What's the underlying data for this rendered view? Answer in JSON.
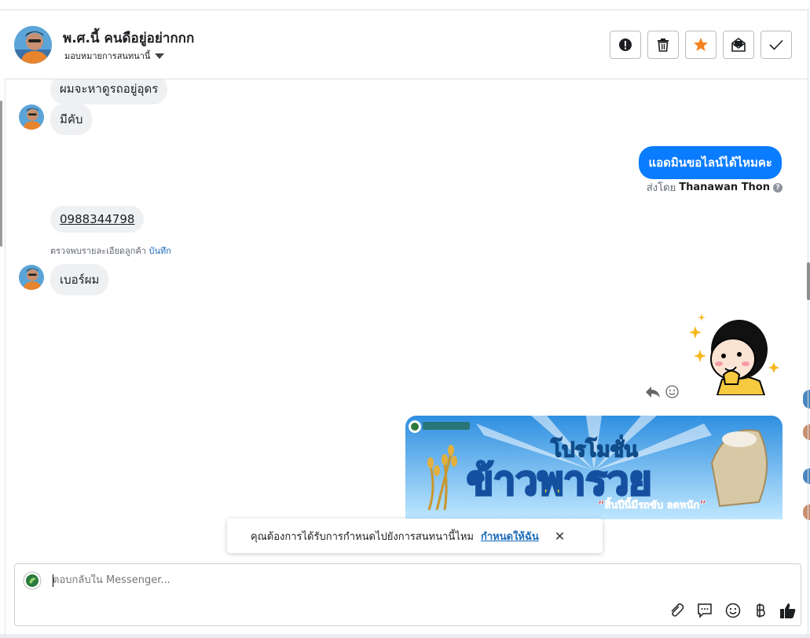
{
  "header": {
    "contact_name": "พ.ศ.นี้ คนดือยู่อย่ากกก",
    "assign_label": "มอบหมายการสนทนานี้",
    "buttons": [
      "spam-alert",
      "delete",
      "star",
      "mark-unread",
      "done"
    ],
    "star_color": "#f5821f"
  },
  "messages": {
    "in_1": "ผมจะหาดูรถอยู่อุดร",
    "in_2": "มีคับ",
    "out_1": "แอดมินขอไลน์ได้ไหมคะ",
    "sent_by_prefix": "ส่งโดย",
    "sent_by_name": "Thanawan Thon",
    "in_phone": "0988344798",
    "detail_text": "ตรวจพบรายละเอียดลูกค้า",
    "detail_link": "บันทึก",
    "in_3": "เบอร์ผม",
    "promo_line1": "โปรโมชั่น",
    "promo_line2": "ข้าวพารวย",
    "promo_line3": "“สิ้นปีนี้มีรถขับ ลดหนัก”"
  },
  "toast": {
    "message": "คุณต้องการได้รับการกำหนดไปยังการสนทนานี้ไหม",
    "link": "กำหนดให้ฉัน",
    "close": "✕"
  },
  "composer": {
    "placeholder": "ตอบกลับใน Messenger..."
  },
  "colors": {
    "accent": "#0a7cff",
    "link": "#1a6bb8",
    "bubble_in": "#eff0f2"
  }
}
